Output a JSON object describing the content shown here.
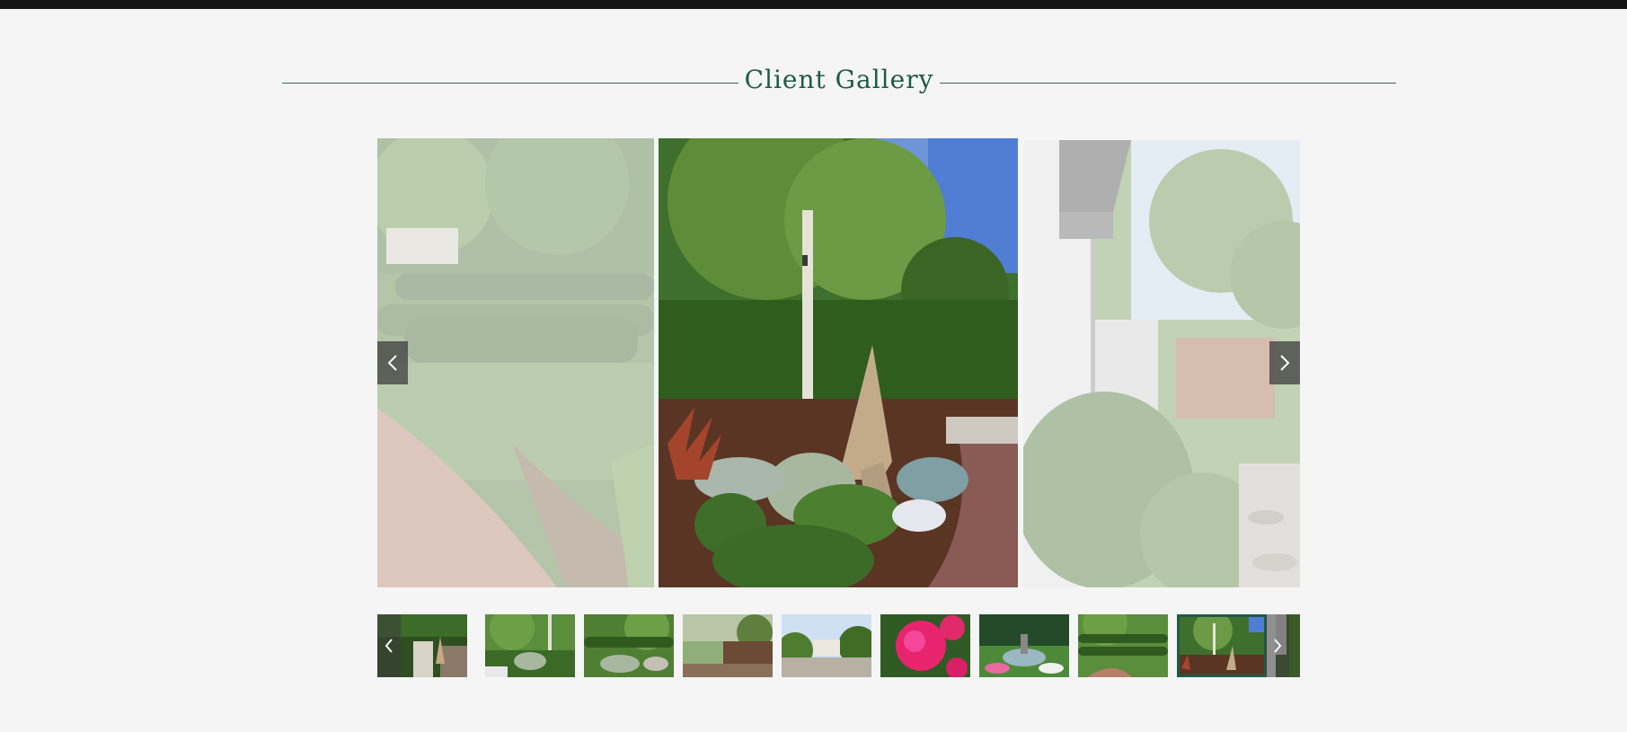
{
  "gallery": {
    "title": "Client Gallery",
    "accent_color": "#1f5a45",
    "prev_icon": "chevron-left-icon",
    "next_icon": "chevron-right-icon"
  },
  "slides": [
    {
      "state": "previous",
      "description_icon": "hedge-garden-photo"
    },
    {
      "state": "current",
      "description_icon": "birch-rock-garden-photo"
    },
    {
      "state": "next",
      "description_icon": "side-yard-photo"
    }
  ],
  "thumbnails": {
    "count": 10,
    "active_index": 8
  }
}
